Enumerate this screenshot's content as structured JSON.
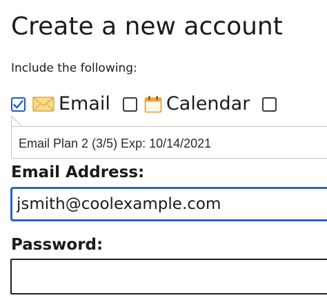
{
  "page": {
    "title": "Create a new account",
    "include_label": "Include the following:"
  },
  "options": [
    {
      "label": "Email",
      "checked": true,
      "icon": "envelope-icon"
    },
    {
      "label": "Calendar",
      "checked": false,
      "icon": "calendar-icon"
    },
    {
      "label": "",
      "checked": false,
      "icon": ""
    }
  ],
  "plan": {
    "text": "Email Plan 2 (3/5) Exp: 10/14/2021"
  },
  "email_field": {
    "label": "Email Address:",
    "value": "jsmith@coolexample.com"
  },
  "password_field": {
    "label": "Password:",
    "value": ""
  },
  "colors": {
    "accent": "#2c5fd1",
    "envelope": "#f5d37a",
    "calendar": "#f0a640"
  }
}
